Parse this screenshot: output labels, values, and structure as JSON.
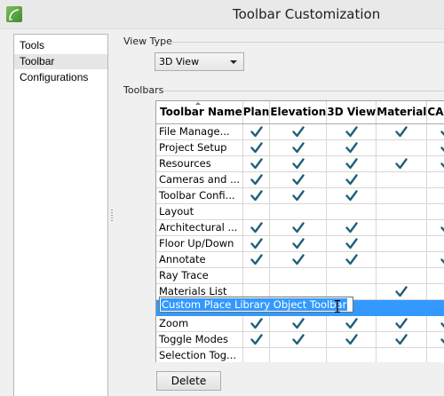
{
  "window": {
    "title": "Toolbar Customization",
    "app_icon": "chief-architect-logo-icon"
  },
  "sidebar": {
    "items": [
      {
        "label": "Tools",
        "selected": false
      },
      {
        "label": "Toolbar",
        "selected": true
      },
      {
        "label": "Configurations",
        "selected": false
      }
    ]
  },
  "view_type": {
    "label": "View Type",
    "selected": "3D View"
  },
  "toolbars": {
    "label": "Toolbars",
    "columns": [
      "Toolbar Name",
      "Plan",
      "Elevation",
      "3D View",
      "Material",
      "CAD D"
    ],
    "rows": [
      {
        "name": "File Manage...",
        "checks": [
          true,
          true,
          true,
          true,
          true
        ]
      },
      {
        "name": "Project Setup",
        "checks": [
          true,
          true,
          true,
          false,
          true
        ]
      },
      {
        "name": "Resources",
        "checks": [
          true,
          true,
          true,
          true,
          true
        ]
      },
      {
        "name": "Cameras and ...",
        "checks": [
          true,
          true,
          true,
          false,
          false
        ]
      },
      {
        "name": "Toolbar Confi...",
        "checks": [
          true,
          true,
          true,
          false,
          false
        ]
      },
      {
        "name": "Layout",
        "checks": [
          false,
          false,
          false,
          false,
          false
        ]
      },
      {
        "name": "Architectural ...",
        "checks": [
          true,
          true,
          true,
          false,
          true
        ]
      },
      {
        "name": "Floor Up/Down",
        "checks": [
          true,
          true,
          true,
          false,
          false
        ]
      },
      {
        "name": "Annotate",
        "checks": [
          true,
          true,
          true,
          false,
          true
        ]
      },
      {
        "name": "Ray Trace",
        "checks": [
          false,
          false,
          false,
          false,
          false
        ]
      },
      {
        "name": "Materials List",
        "checks": [
          false,
          false,
          false,
          true,
          false
        ]
      },
      {
        "name": "Custom Place Library Object Toolbar",
        "checks": [
          false,
          false,
          false,
          false,
          false
        ],
        "editing": true
      },
      {
        "name": "Zoom",
        "checks": [
          true,
          true,
          true,
          true,
          true
        ]
      },
      {
        "name": "Toggle Modes",
        "checks": [
          true,
          true,
          true,
          true,
          true
        ]
      },
      {
        "name": "Selection Tog...",
        "checks": [
          false,
          false,
          false,
          false,
          false
        ]
      }
    ]
  },
  "actions": {
    "delete_label": "Delete"
  },
  "colors": {
    "check": "#1f5f7a",
    "selection": "#3399ff"
  }
}
